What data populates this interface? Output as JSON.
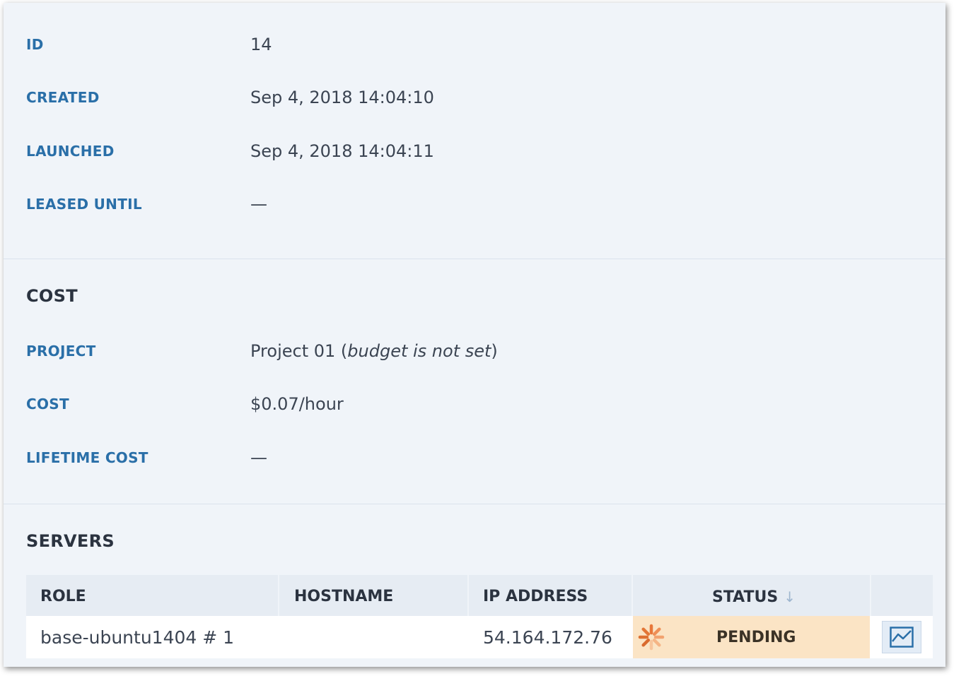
{
  "details": {
    "rows": [
      {
        "label": "ID",
        "value": "14"
      },
      {
        "label": "CREATED",
        "value": "Sep 4, 2018 14:04:10"
      },
      {
        "label": "LAUNCHED",
        "value": "Sep 4, 2018 14:04:11"
      },
      {
        "label": "LEASED UNTIL",
        "value": "—"
      }
    ]
  },
  "cost": {
    "title": "COST",
    "project_label": "PROJECT",
    "project_name": "Project 01",
    "project_budget_note": "budget is not set",
    "cost_label": "COST",
    "cost_value": "$0.07/hour",
    "lifetime_label": "LIFETIME COST",
    "lifetime_value": "—"
  },
  "servers": {
    "title": "SERVERS",
    "columns": [
      "ROLE",
      "HOSTNAME",
      "IP ADDRESS",
      "STATUS"
    ],
    "rows": [
      {
        "role": "base-ubuntu1404 # 1",
        "hostname": "",
        "ip": "54.164.172.76",
        "status": "PENDING"
      }
    ],
    "sort_icon": "arrow-down-icon",
    "status_icon": "spinner-icon",
    "stats_icon": "line-chart-icon"
  },
  "colors": {
    "label": "#2a6fa8",
    "status_pending_bg": "#fbe4c5",
    "panel_bg": "#f0f4f9",
    "spinner": "#e8773a"
  }
}
